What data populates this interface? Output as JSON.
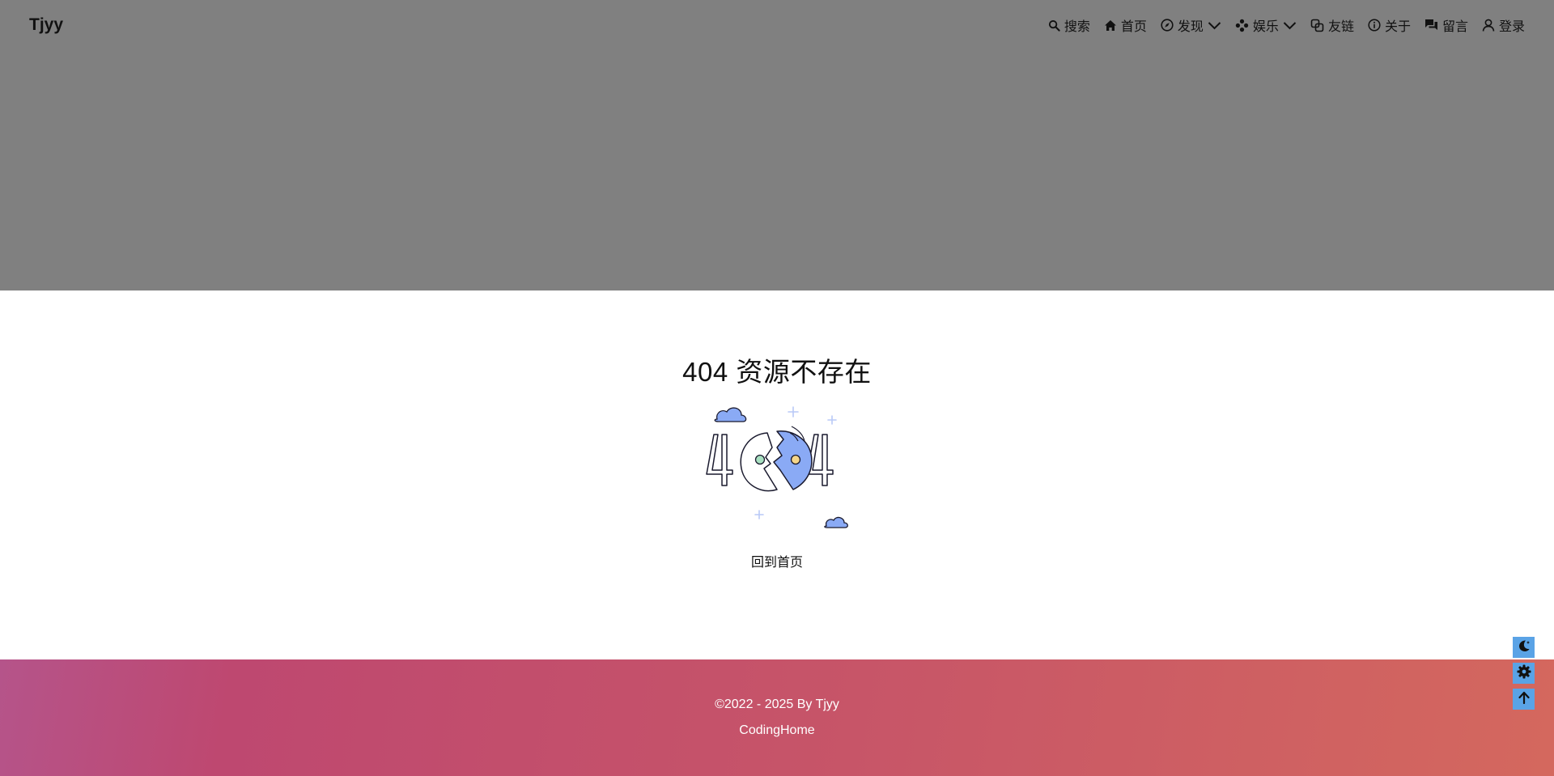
{
  "header": {
    "brand": "Tjyy",
    "nav": [
      {
        "label": "搜索",
        "icon": "search-icon"
      },
      {
        "label": "首页",
        "icon": "home-icon"
      },
      {
        "label": "发现",
        "icon": "compass-icon",
        "dropdown": true
      },
      {
        "label": "娱乐",
        "icon": "gamepad-icon",
        "dropdown": true
      },
      {
        "label": "友链",
        "icon": "link-icon"
      },
      {
        "label": "关于",
        "icon": "info-icon"
      },
      {
        "label": "留言",
        "icon": "chat-icon"
      },
      {
        "label": "登录",
        "icon": "user-icon"
      }
    ]
  },
  "main": {
    "title": "404 资源不存在",
    "illustration_icon": "404-illustration",
    "home_link": "回到首页"
  },
  "footer": {
    "copyright": "©2022 - 2025 By Tjyy",
    "site_name": "CodingHome"
  },
  "floating_buttons": [
    {
      "icon": "moon-icon"
    },
    {
      "icon": "gear-icon"
    },
    {
      "icon": "arrow-up-icon"
    }
  ],
  "colors": {
    "hero_bg": "#808080",
    "accent_blue": "#8aaaf5",
    "float_btn": "#5aa3e6",
    "footer_gradient_start": "#b5548a",
    "footer_gradient_end": "#d4685e"
  }
}
